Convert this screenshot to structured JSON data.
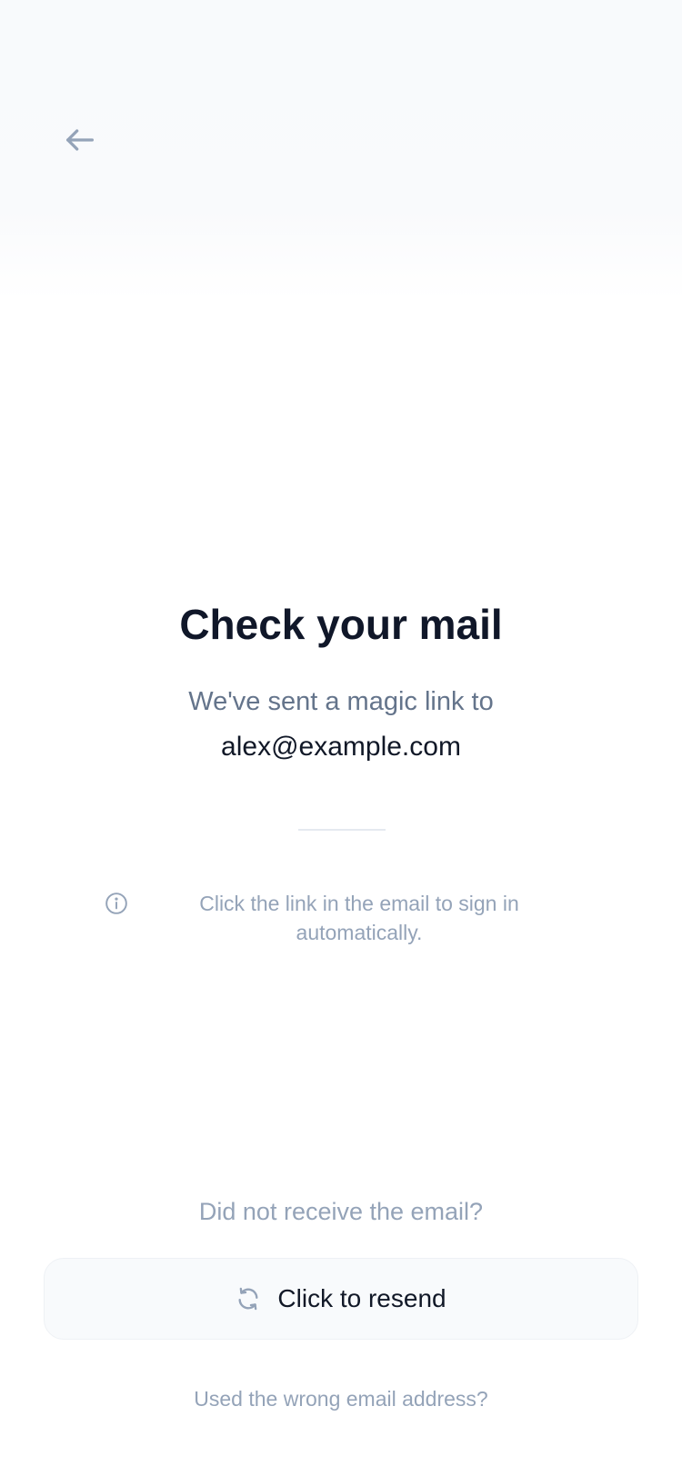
{
  "screen": {
    "title": "Check your mail",
    "subtitle": "We've sent a magic link to",
    "email": "alex@example.com",
    "info_text": "Click the link in the email to sign in automatically.",
    "did_not_receive": "Did not receive the email?",
    "resend_label": "Click to resend",
    "wrong_email_link": "Used the wrong email address?"
  },
  "icons": {
    "back": "arrow-left-icon",
    "info": "info-circle-icon",
    "resend": "refresh-icon"
  },
  "colors": {
    "title": "#101729",
    "muted": "#94a3b8",
    "subtitle": "#64748b",
    "button_bg": "#f8fafc"
  }
}
